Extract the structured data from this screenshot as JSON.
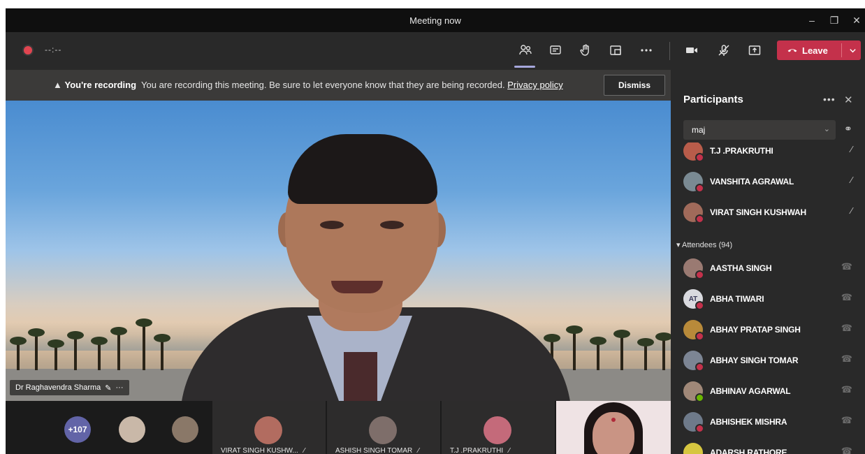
{
  "window": {
    "title": "Meeting now",
    "min_icon": "minimize-icon",
    "max_icon": "maximize-icon",
    "close_icon": "close-icon"
  },
  "toolbar": {
    "timer": "--:--",
    "buttons": [
      "people-icon",
      "chat-icon",
      "raise-hand-icon",
      "rooms-icon",
      "more-icon",
      "camera-icon",
      "mic-off-icon",
      "share-icon"
    ],
    "leave_label": "Leave"
  },
  "banner": {
    "bold": "You're recording",
    "message": "You are recording this meeting. Be sure to let everyone know that they are being recorded.",
    "link": "Privacy policy",
    "dismiss": "Dismiss"
  },
  "video": {
    "speaker": "Dr Raghavendra Sharma"
  },
  "strip": {
    "overflow": "+107",
    "tiles": [
      {
        "name": "VIRAT SINGH KUSHW..."
      },
      {
        "name": "ASHISH SINGH TOMAR"
      },
      {
        "name": "T.J .PRAKRUTHI"
      }
    ]
  },
  "participants": {
    "title": "Participants",
    "search_value": "maj",
    "presenters": [
      {
        "name": "T.J .PRAKRUTHI",
        "color": "#b85c4a",
        "status": "busy"
      },
      {
        "name": "VANSHITA AGRAWAL",
        "color": "#7a8a93",
        "status": "busy"
      },
      {
        "name": "VIRAT SINGH KUSHWAH",
        "color": "#a06a5a",
        "status": "busy"
      }
    ],
    "attendees_label": "Attendees (94)",
    "attendees": [
      {
        "name": "AASTHA SINGH",
        "initials": "",
        "color": "#9a7a72",
        "status": "busy"
      },
      {
        "name": "ABHA TIWARI",
        "initials": "AT",
        "color": "#d9dadf",
        "status": "busy"
      },
      {
        "name": "ABHAY PRATAP SINGH",
        "initials": "",
        "color": "#b88a3a",
        "status": "busy"
      },
      {
        "name": "ABHAY SINGH TOMAR",
        "initials": "",
        "color": "#7c8594",
        "status": "busy"
      },
      {
        "name": "ABHINAV AGARWAL",
        "initials": "",
        "color": "#a08878",
        "status": "available"
      },
      {
        "name": "ABHISHEK MISHRA",
        "initials": "",
        "color": "#6e7a8a",
        "status": "busy"
      },
      {
        "name": "ADARSH RATHORE",
        "initials": "",
        "color": "#d6c640",
        "status": "busy"
      }
    ]
  }
}
